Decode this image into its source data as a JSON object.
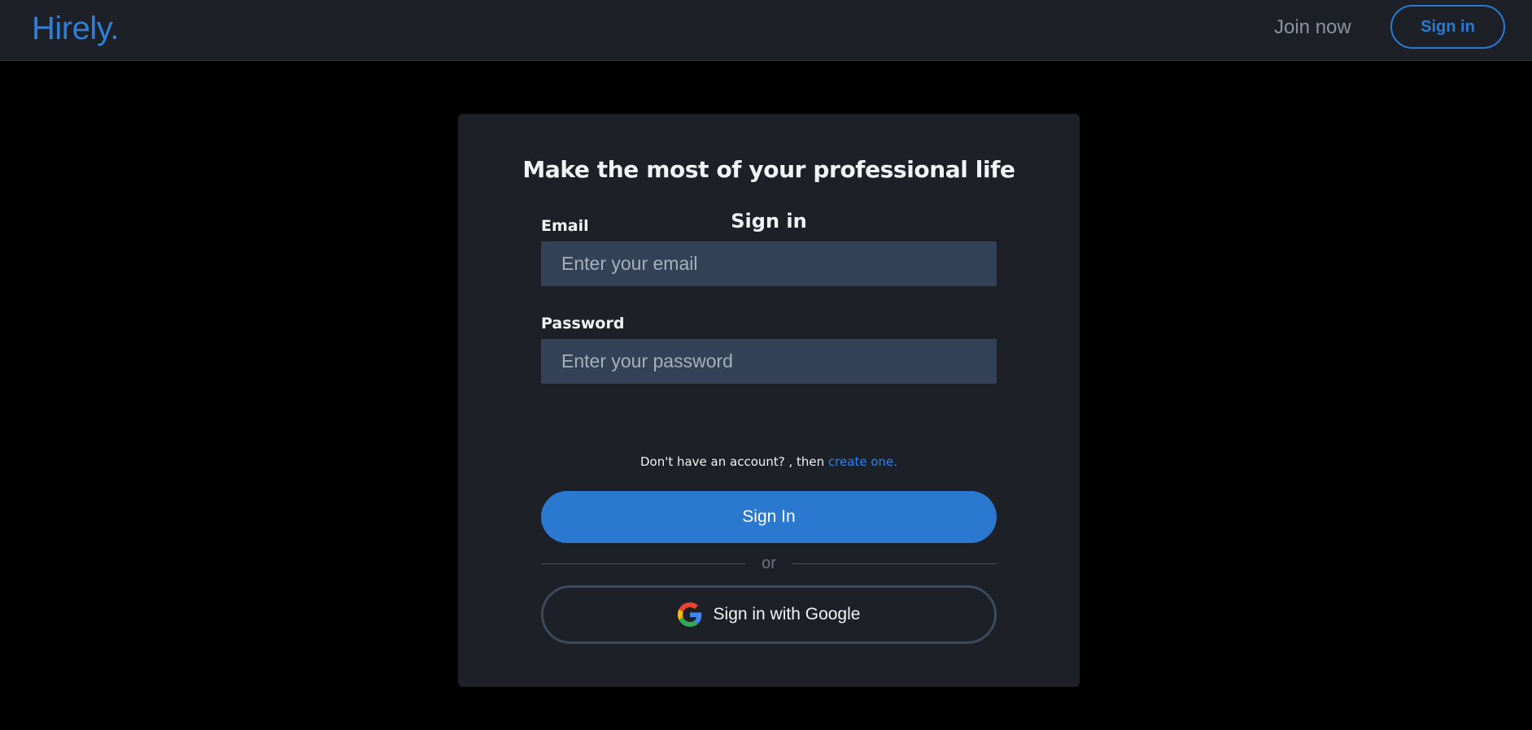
{
  "header": {
    "logo": "Hirely.",
    "join_label": "Join now",
    "signin_label": "Sign in"
  },
  "card": {
    "title": "Make the most of your professional life",
    "subtitle": "Sign in",
    "email": {
      "label": "Email",
      "placeholder": "Enter your email",
      "value": ""
    },
    "password": {
      "label": "Password",
      "placeholder": "Enter your password",
      "value": ""
    },
    "account_prompt": "Don't have an account? , then ",
    "create_link": "create one.",
    "signin_button": "Sign In",
    "divider_text": "or",
    "google_button": "Sign in with Google"
  },
  "colors": {
    "accent": "#2a78d0",
    "link": "#2a84ef",
    "page_bg": "#000000",
    "surface": "#1d2026",
    "input_bg": "#334257"
  },
  "icons": {
    "google": "google-icon"
  }
}
